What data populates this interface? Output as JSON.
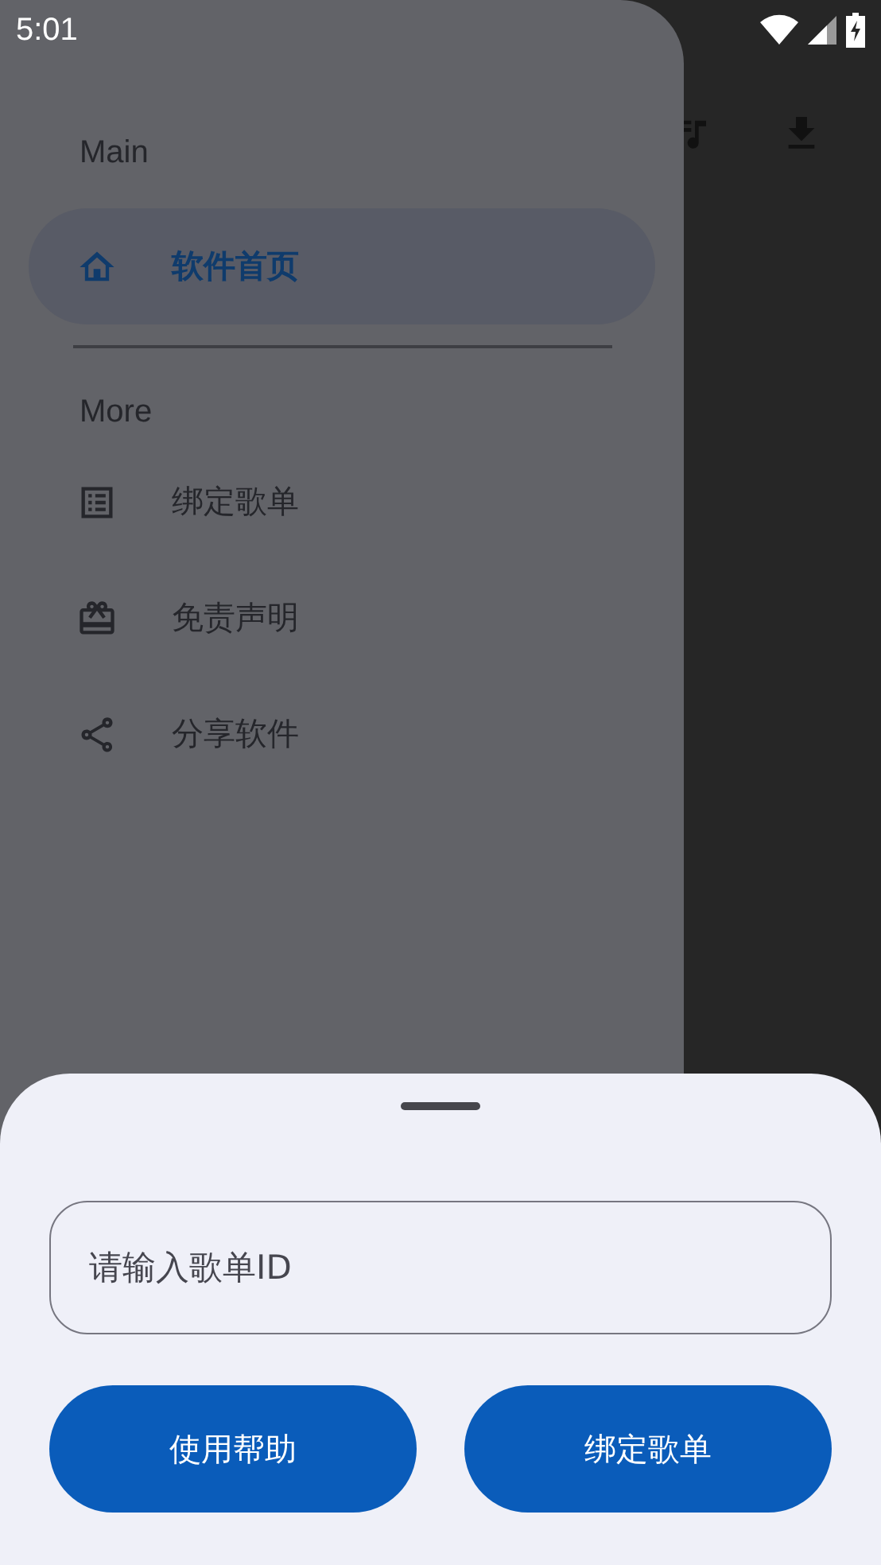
{
  "status_bar": {
    "time": "5:01"
  },
  "drawer": {
    "sections": [
      {
        "title": "Main",
        "items": [
          {
            "label": "软件首页",
            "selected": true
          }
        ]
      },
      {
        "title": "More",
        "items": [
          {
            "label": "绑定歌单",
            "selected": false
          },
          {
            "label": "免责声明",
            "selected": false
          },
          {
            "label": "分享软件",
            "selected": false
          }
        ]
      }
    ]
  },
  "sheet": {
    "input": {
      "placeholder": "请输入歌单ID"
    },
    "buttons": [
      "使用帮助",
      "绑定歌单"
    ]
  }
}
